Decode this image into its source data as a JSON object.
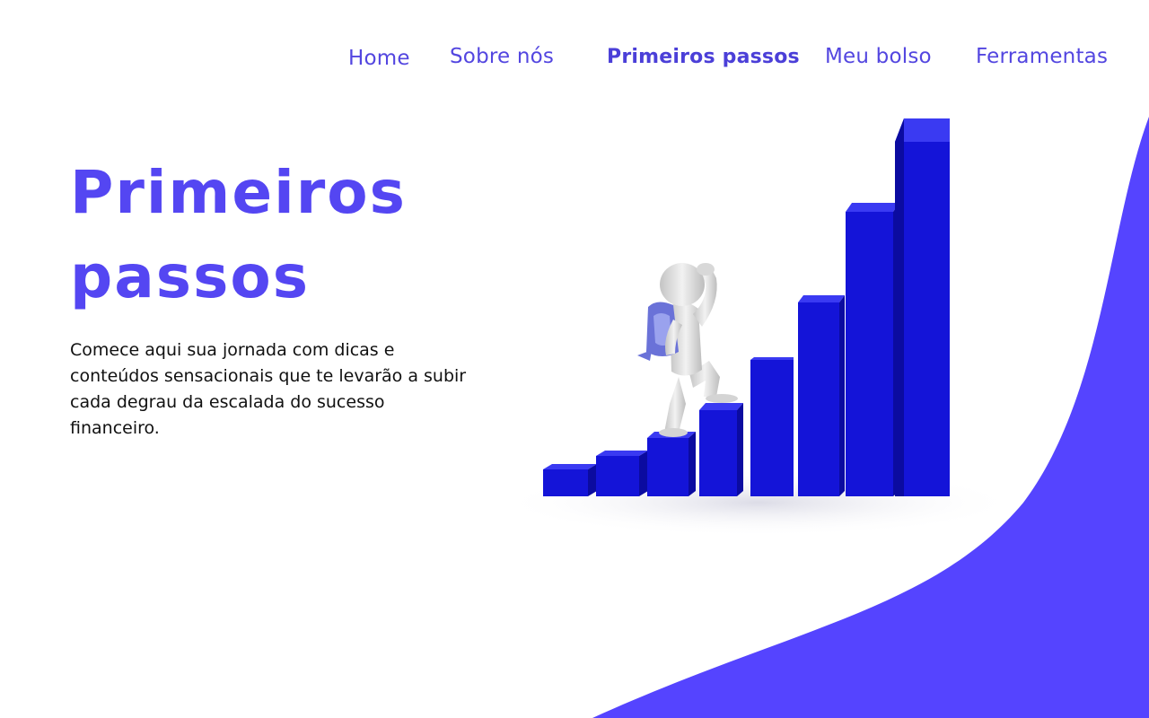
{
  "nav": {
    "items": [
      {
        "label": "Home",
        "active": false
      },
      {
        "label": "Sobre nós",
        "active": false
      },
      {
        "label": "Primeiros passos",
        "active": true
      },
      {
        "label": "Meu bolso",
        "active": false
      },
      {
        "label": "Ferramentas",
        "active": false
      }
    ]
  },
  "hero": {
    "title": "Primeiros passos",
    "description": "Comece aqui sua jornada com dicas e conteúdos sensacionais que te levarão a subir cada degrau da escalada do sucesso financeiro."
  },
  "illustration": {
    "icon": "climbing-figure-bar-chart-illustration"
  },
  "colors": {
    "accent": "#5446f2",
    "wave": "#5544ff",
    "bars": "#1010e0",
    "text": "#111111",
    "background": "#ffffff"
  }
}
